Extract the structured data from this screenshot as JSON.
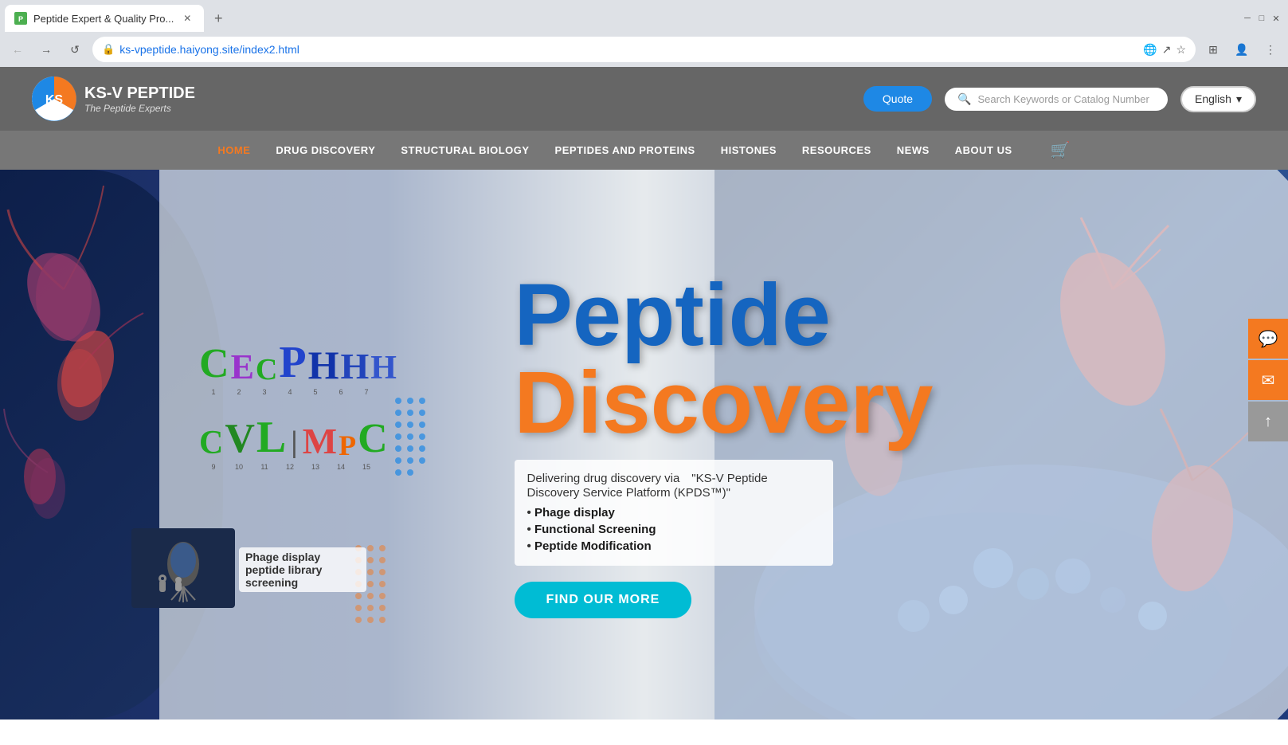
{
  "browser": {
    "tab_title": "Peptide Expert & Quality Pro...",
    "tab_favicon": "P",
    "url": "ks-vpeptide.haiyong.site/index2.html",
    "new_tab_label": "+",
    "back_disabled": false,
    "forward_disabled": true
  },
  "header": {
    "logo_company": "KS-V PEPTIDE",
    "logo_tagline": "The Peptide Experts",
    "quote_label": "Quote",
    "search_placeholder": "Search Keywords or Catalog Number",
    "lang_label": "English",
    "lang_arrow": "▾"
  },
  "nav": {
    "items": [
      {
        "label": "HOME",
        "active": true
      },
      {
        "label": "DRUG DISCOVERY",
        "active": false
      },
      {
        "label": "STRUCTURAL BIOLOGY",
        "active": false
      },
      {
        "label": "PEPTIDES AND PROTEINS",
        "active": false
      },
      {
        "label": "HISTONES",
        "active": false
      },
      {
        "label": "RESOURCES",
        "active": false
      },
      {
        "label": "NEWS",
        "active": false
      },
      {
        "label": "ABOUT US",
        "active": false
      }
    ]
  },
  "hero": {
    "title_line1": "Peptide",
    "title_line2": "Discovery",
    "description_intro": "Delivering drug discovery via　\"KS-V Peptide Discovery Service Platform (KPDS™)\"",
    "bullets": [
      "Phage display",
      "Functional Screening",
      "Peptide Modification"
    ],
    "find_more_label": "FIND OUR MORE",
    "phage_label": "Phage display peptide library screening",
    "seq_row1": [
      "C",
      "E",
      "C",
      "P",
      "H",
      "H",
      "H"
    ],
    "seq_row2": [
      "C",
      "V",
      "L",
      "I",
      "M",
      "P",
      "C"
    ],
    "seq_numbers1": "1  2  3  4  5  6  7",
    "seq_numbers2": "9  10  11  12  13  14  15"
  },
  "float_contact": {
    "phone_icon": "💬",
    "email_icon": "✉",
    "top_icon": "↑"
  },
  "colors": {
    "nav_active": "#f47920",
    "hero_blue": "#1565c0",
    "hero_orange": "#f47920",
    "find_more_bg": "#00bcd4",
    "quote_bg": "#1e88e5"
  }
}
